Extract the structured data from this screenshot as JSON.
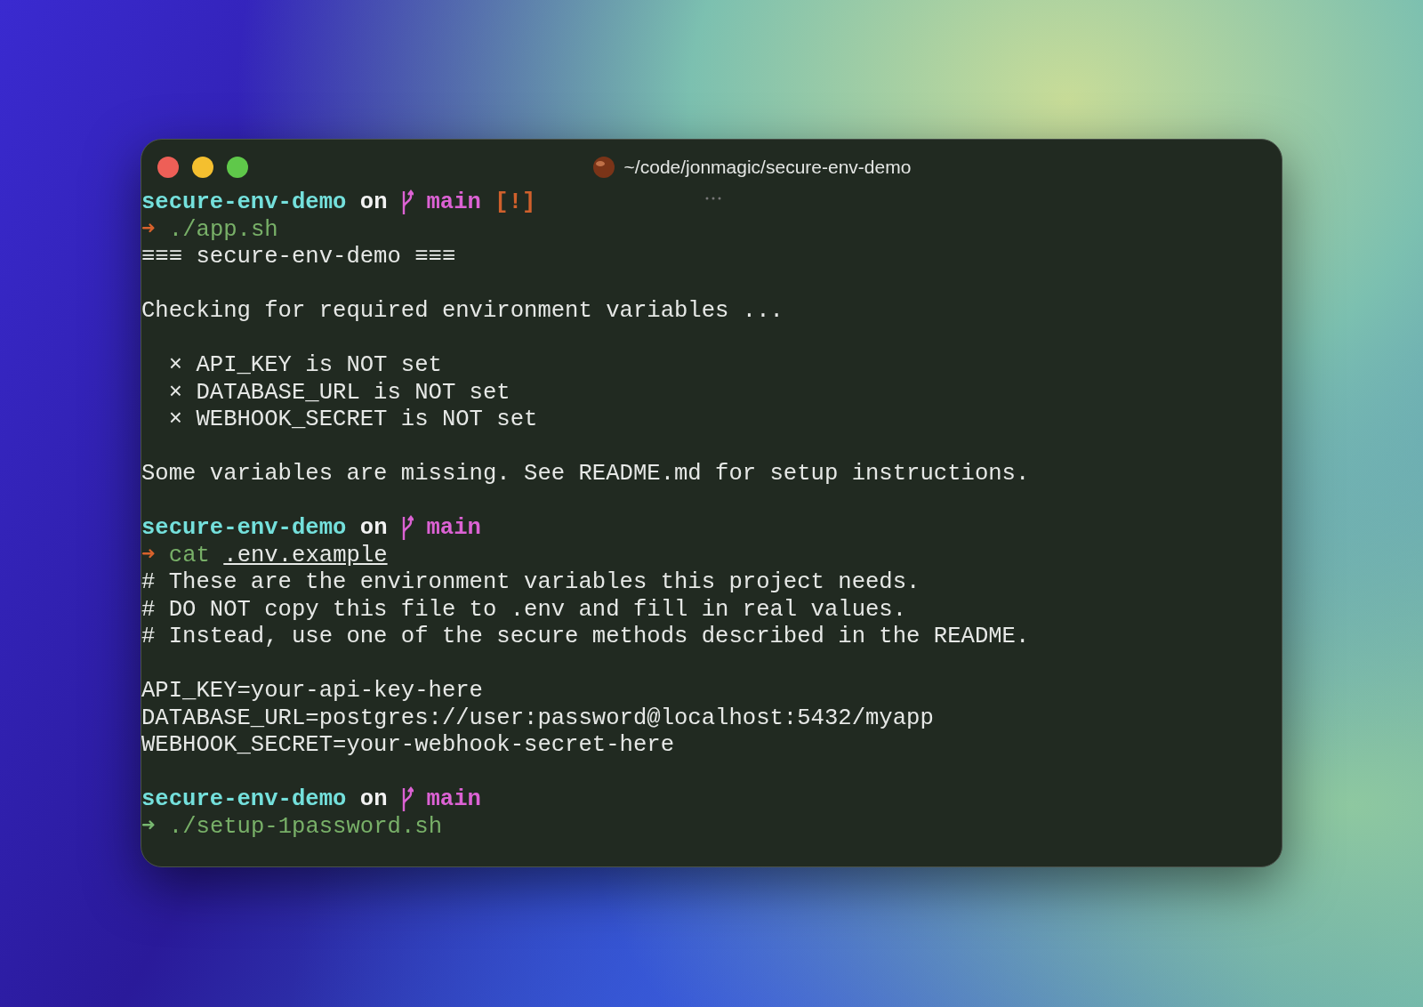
{
  "window": {
    "title": "~/code/jonmagic/secure-env-demo"
  },
  "lines": [
    {
      "kind": "prompt",
      "directory": "secure-env-demo",
      "on": "on",
      "branch": "main",
      "git_status": "[!]"
    },
    {
      "kind": "command",
      "arrow": "➜",
      "success": false,
      "command": "./app.sh"
    },
    {
      "kind": "output",
      "text": "≡≡≡ secure-env-demo ≡≡≡"
    },
    {
      "kind": "blank"
    },
    {
      "kind": "output",
      "text": "Checking for required environment variables ..."
    },
    {
      "kind": "blank"
    },
    {
      "kind": "output",
      "text": "  × API_KEY is NOT set"
    },
    {
      "kind": "output",
      "text": "  × DATABASE_URL is NOT set"
    },
    {
      "kind": "output",
      "text": "  × WEBHOOK_SECRET is NOT set"
    },
    {
      "kind": "blank"
    },
    {
      "kind": "output",
      "text": "Some variables are missing. See README.md for setup instructions."
    },
    {
      "kind": "blank"
    },
    {
      "kind": "prompt",
      "directory": "secure-env-demo",
      "on": "on",
      "branch": "main"
    },
    {
      "kind": "command",
      "arrow": "➜",
      "success": false,
      "command": "cat",
      "argument": ".env.example"
    },
    {
      "kind": "output",
      "text": "# These are the environment variables this project needs."
    },
    {
      "kind": "output",
      "text": "# DO NOT copy this file to .env and fill in real values."
    },
    {
      "kind": "output",
      "text": "# Instead, use one of the secure methods described in the README."
    },
    {
      "kind": "blank"
    },
    {
      "kind": "output",
      "text": "API_KEY=your-api-key-here"
    },
    {
      "kind": "output",
      "text": "DATABASE_URL=postgres://user:password@localhost:5432/myapp"
    },
    {
      "kind": "output",
      "text": "WEBHOOK_SECRET=your-webhook-secret-here"
    },
    {
      "kind": "blank"
    },
    {
      "kind": "prompt",
      "directory": "secure-env-demo",
      "on": "on",
      "branch": "main"
    },
    {
      "kind": "command",
      "arrow": "➜",
      "success": true,
      "command": "./setup-1password.sh"
    }
  ]
}
